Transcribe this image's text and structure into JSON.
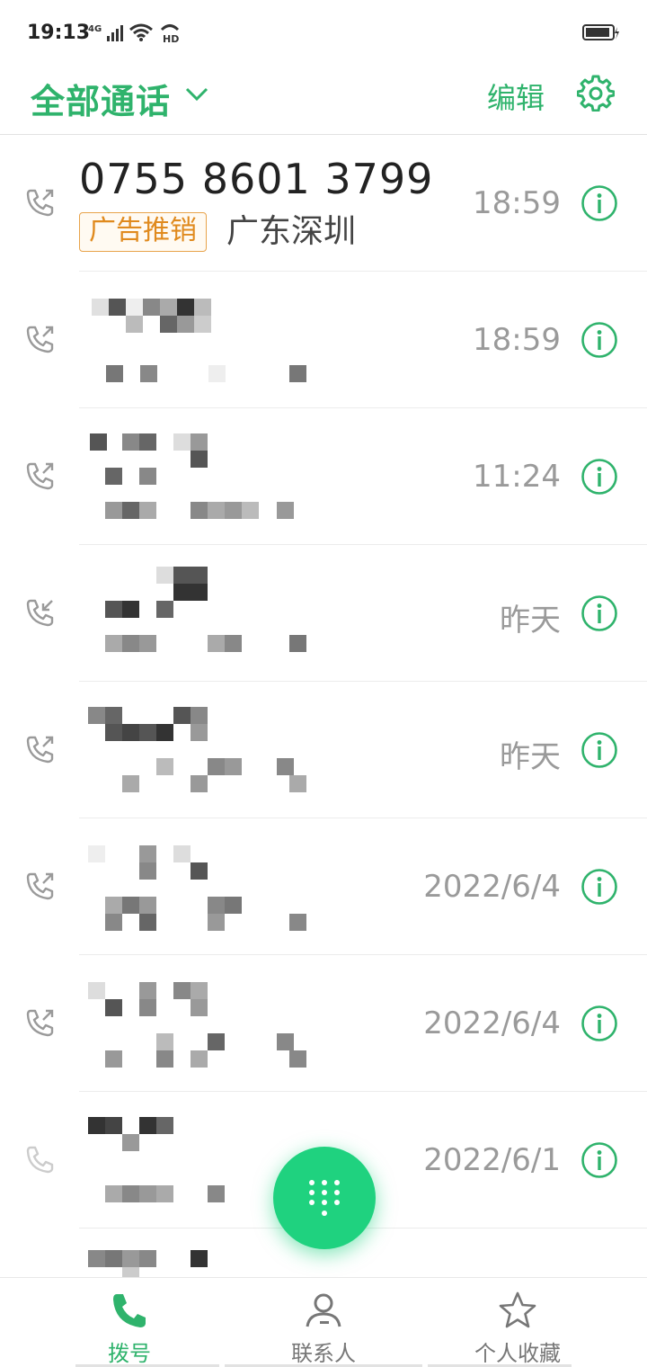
{
  "status_bar": {
    "time": "19:13",
    "network": "4G",
    "hd": "HD"
  },
  "header": {
    "title": "全部通话",
    "edit_label": "编辑"
  },
  "calls": [
    {
      "number": "0755 8601 3799",
      "tag": "广告推销",
      "location": "广东深圳",
      "time": "18:59",
      "direction": "outgoing"
    },
    {
      "time": "18:59",
      "direction": "outgoing"
    },
    {
      "time": "11:24",
      "direction": "outgoing"
    },
    {
      "time": "昨天",
      "direction": "incoming"
    },
    {
      "time": "昨天",
      "direction": "outgoing"
    },
    {
      "time": "2022/6/4",
      "direction": "outgoing"
    },
    {
      "time": "2022/6/4",
      "direction": "outgoing"
    },
    {
      "time": "2022/6/1",
      "direction": "outgoing"
    }
  ],
  "nav": {
    "items": [
      {
        "label": "拨号",
        "icon": "phone-icon",
        "active": true
      },
      {
        "label": "联系人",
        "icon": "person-icon",
        "active": false
      },
      {
        "label": "个人收藏",
        "icon": "star-icon",
        "active": false
      }
    ]
  },
  "colors": {
    "accent": "#2fb36c",
    "fab": "#1fd27f",
    "tag": "#e08a1e",
    "time": "#9a9a9a"
  }
}
